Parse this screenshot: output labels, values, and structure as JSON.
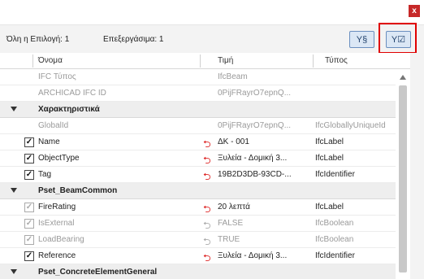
{
  "window": {
    "close_label": "x"
  },
  "info": {
    "selection_label": "Όλη η Επιλογή: 1",
    "editable_label": "Επεξεργάσιμα: 1",
    "filter_section_btn": "Y§",
    "filter_check_btn": "Y☑"
  },
  "table": {
    "columns": {
      "name": "Όνομα",
      "value": "Τιμή",
      "type": "Τύπος"
    },
    "rows": [
      {
        "kind": "prop",
        "name": "IFC Τύπος",
        "value": "IfcBeam",
        "type": "",
        "gray": true,
        "checkbox": "none",
        "link": "none"
      },
      {
        "kind": "prop",
        "name": "ARCHICAD IFC ID",
        "value": "0PijFRayrO7epnQ...",
        "type": "",
        "gray": true,
        "checkbox": "none",
        "link": "none"
      },
      {
        "kind": "group",
        "name": "Χαρακτηριστικά"
      },
      {
        "kind": "prop",
        "name": "GlobalId",
        "value": "0PijFRayrO7epnQ...",
        "type": "IfcGloballyUniqueId",
        "gray": true,
        "checkbox": "none",
        "link": "none"
      },
      {
        "kind": "prop",
        "name": "Name",
        "value": "ΔΚ - 001",
        "type": "IfcLabel",
        "gray": false,
        "checkbox": "checked",
        "link": "red"
      },
      {
        "kind": "prop",
        "name": "ObjectType",
        "value": "Ξυλεία - Δομική 3...",
        "type": "IfcLabel",
        "gray": false,
        "checkbox": "checked",
        "link": "red"
      },
      {
        "kind": "prop",
        "name": "Tag",
        "value": "19B2D3DB-93CD-...",
        "type": "IfcIdentifier",
        "gray": false,
        "checkbox": "checked",
        "link": "red"
      },
      {
        "kind": "group",
        "name": "Pset_BeamCommon"
      },
      {
        "kind": "prop",
        "name": "FireRating",
        "value": "20 λεπτά",
        "type": "IfcLabel",
        "gray": false,
        "checkbox": "checked-dis",
        "link": "red"
      },
      {
        "kind": "prop",
        "name": "IsExternal",
        "value": "FALSE",
        "type": "IfcBoolean",
        "gray": true,
        "checkbox": "checked-dis",
        "link": "gray"
      },
      {
        "kind": "prop",
        "name": "LoadBearing",
        "value": "TRUE",
        "type": "IfcBoolean",
        "gray": true,
        "checkbox": "checked-dis",
        "link": "gray"
      },
      {
        "kind": "prop",
        "name": "Reference",
        "value": "Ξυλεία - Δομική 3...",
        "type": "IfcIdentifier",
        "gray": false,
        "checkbox": "checked",
        "link": "red"
      },
      {
        "kind": "group",
        "name": "Pset_ConcreteElementGeneral"
      }
    ]
  },
  "colors": {
    "accent_red": "#d22222",
    "highlight": "#e00000",
    "group_bg": "#eeeeee"
  }
}
